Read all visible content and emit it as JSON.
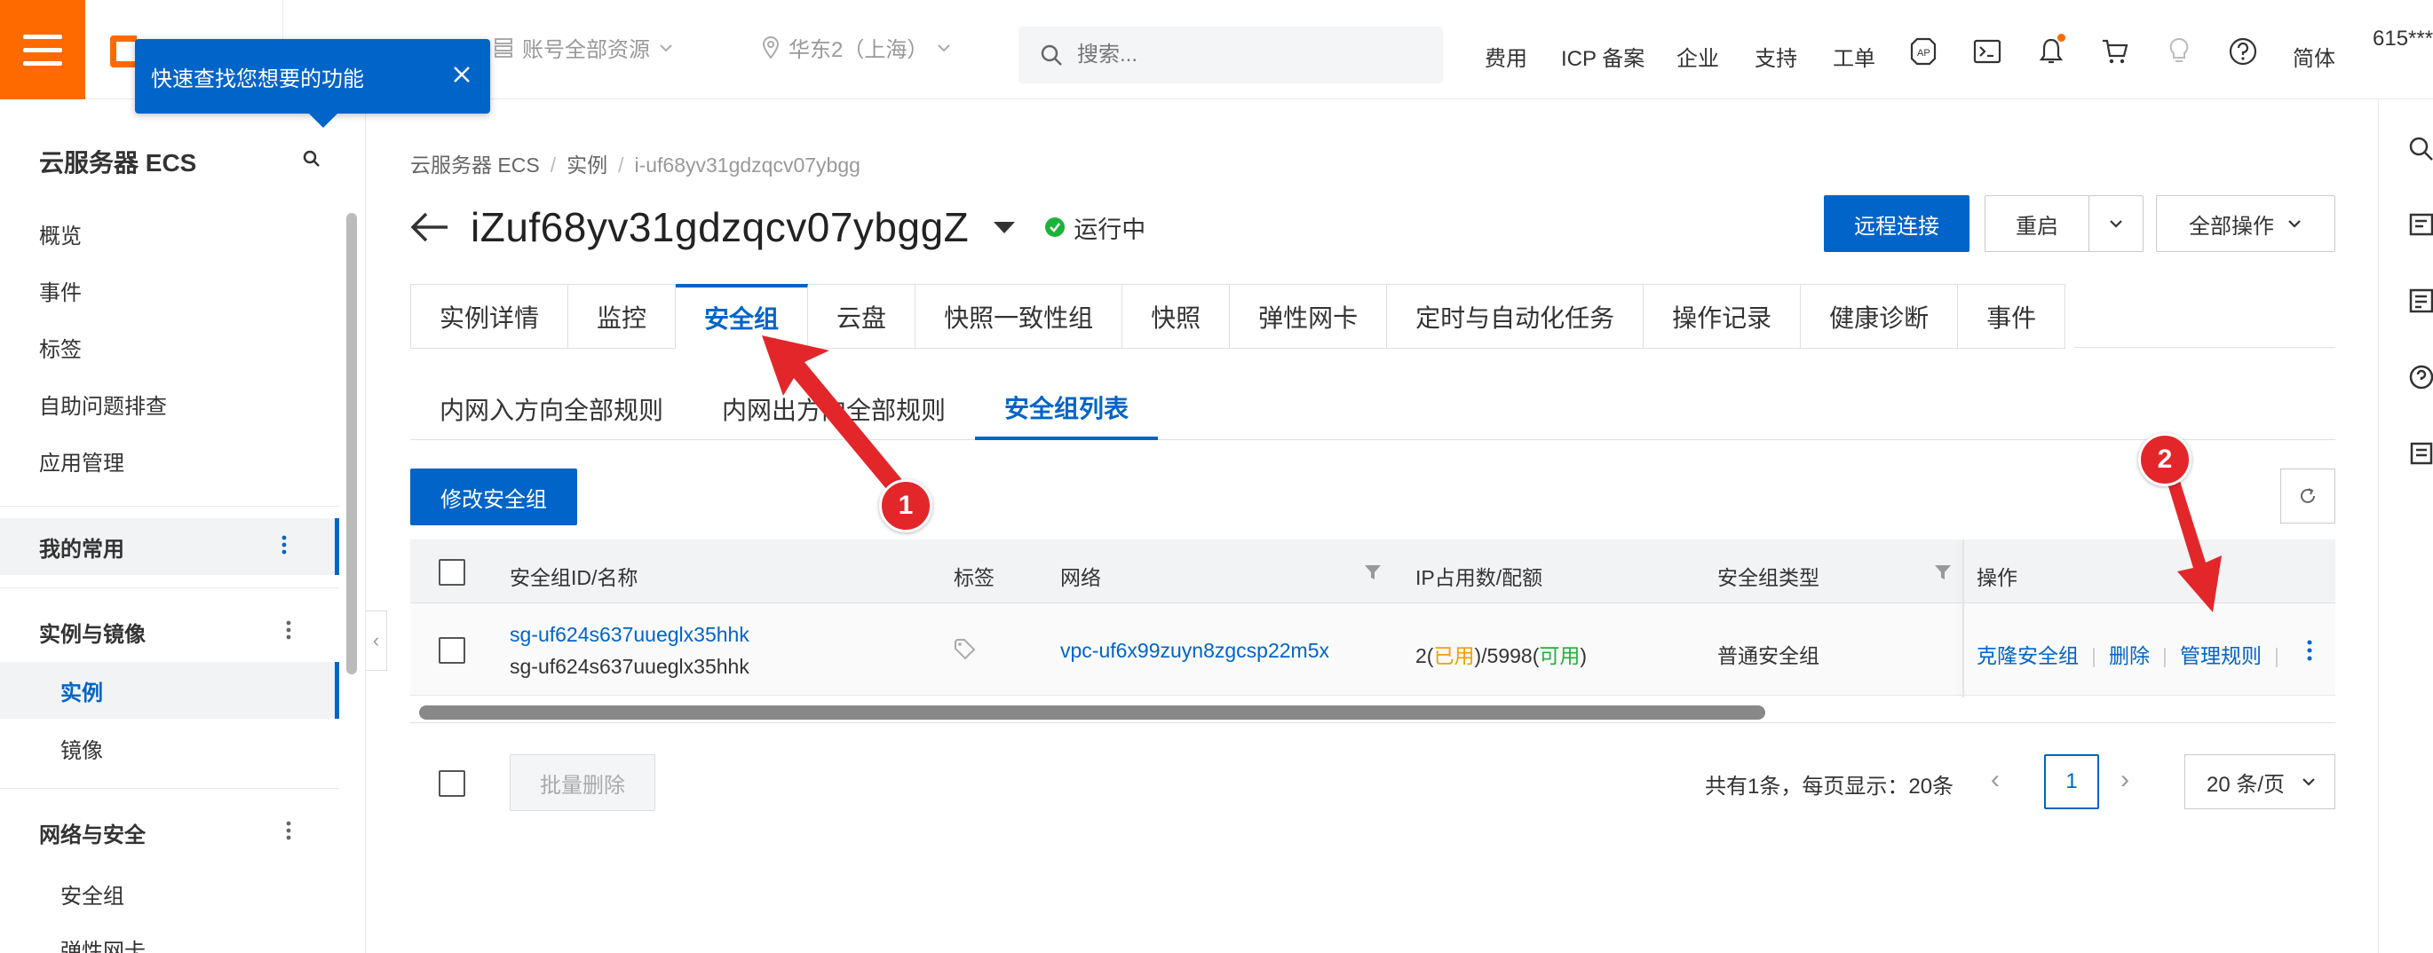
{
  "topbar": {
    "resource_label": "账号全部资源",
    "region_label": "华东2（上海）",
    "search_placeholder": "搜索...",
    "links": [
      "费用",
      "ICP 备案",
      "企业",
      "支持",
      "工单"
    ],
    "lang": "简体",
    "account": "615***"
  },
  "tooltip": {
    "text": "快速查找您想要的功能"
  },
  "sidebar": {
    "title": "云服务器 ECS",
    "top_items": [
      "概览",
      "事件",
      "标签",
      "自助问题排查",
      "应用管理"
    ],
    "favorites": "我的常用",
    "group_instances": "实例与镜像",
    "instance_item": "实例",
    "image_item": "镜像",
    "group_network": "网络与安全",
    "sg_item": "安全组",
    "eni_item": "弹性网卡"
  },
  "breadcrumb": {
    "root": "云服务器 ECS",
    "mid": "实例",
    "current": "i-uf68yv31gdzqcv07ybgg"
  },
  "instance": {
    "title": "iZuf68yv31gdzqcv07ybggZ",
    "status": "运行中"
  },
  "actions": {
    "remote": "远程连接",
    "restart": "重启",
    "all_ops": "全部操作"
  },
  "tabs": [
    "实例详情",
    "监控",
    "安全组",
    "云盘",
    "快照一致性组",
    "快照",
    "弹性网卡",
    "定时与自动化任务",
    "操作记录",
    "健康诊断",
    "事件"
  ],
  "subtabs": [
    "内网入方向全部规则",
    "内网出方向全部规则",
    "安全组列表"
  ],
  "modify_btn": "修改安全组",
  "table": {
    "headers": {
      "id": "安全组ID/名称",
      "tag": "标签",
      "network": "网络",
      "ip": "IP占用数/配额",
      "type": "安全组类型",
      "ops": "操作"
    },
    "row": {
      "id": "sg-uf624s637uueglx35hhk",
      "name": "sg-uf624s637uueglx35hhk",
      "network": "vpc-uf6x99zuyn8zgcsp22m5x",
      "ip_used": "2",
      "ip_used_label": "已用",
      "ip_quota": "5998",
      "ip_avail_label": "可用",
      "type": "普通安全组",
      "op_clone": "克隆安全组",
      "op_delete": "删除",
      "op_manage": "管理规则"
    }
  },
  "bulk_delete": "批量删除",
  "pager": {
    "summary": "共有1条，每页显示：20条",
    "page": "1",
    "size": "20 条/页"
  },
  "annotations": {
    "one": "1",
    "two": "2"
  },
  "colors": {
    "brand": "#ff6a00",
    "primary": "#0064c8",
    "arrow": "#e3262a",
    "running": "#1db33a"
  }
}
